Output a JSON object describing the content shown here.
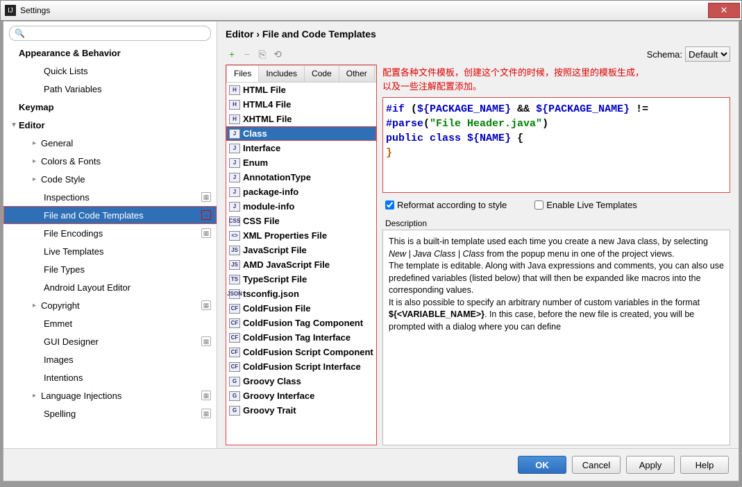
{
  "title": "Settings",
  "breadcrumb": "Editor › File and Code Templates",
  "schema_label": "Schema:",
  "schema_value": "Default",
  "annotation_line1": "配置各种文件模板，创建这个文件的时候，按照这里的模板生成，",
  "annotation_line2": "以及一些注解配置添加。",
  "tree": {
    "appearance": "Appearance & Behavior",
    "quick_lists": "Quick Lists",
    "path_variables": "Path Variables",
    "keymap": "Keymap",
    "editor": "Editor",
    "general": "General",
    "colors": "Colors & Fonts",
    "code_style": "Code Style",
    "inspections": "Inspections",
    "file_templates": "File and Code Templates",
    "file_encodings": "File Encodings",
    "live_templates": "Live Templates",
    "file_types": "File Types",
    "android_layout": "Android Layout Editor",
    "copyright": "Copyright",
    "emmet": "Emmet",
    "gui_designer": "GUI Designer",
    "images": "Images",
    "intentions": "Intentions",
    "language_injections": "Language Injections",
    "spelling": "Spelling"
  },
  "tabs": {
    "files": "Files",
    "includes": "Includes",
    "code": "Code",
    "other": "Other"
  },
  "templates": [
    {
      "icon": "H",
      "label": "HTML File"
    },
    {
      "icon": "H",
      "label": "HTML4 File"
    },
    {
      "icon": "H",
      "label": "XHTML File"
    },
    {
      "icon": "J",
      "label": "Class",
      "selected": true
    },
    {
      "icon": "J",
      "label": "Interface"
    },
    {
      "icon": "J",
      "label": "Enum"
    },
    {
      "icon": "J",
      "label": "AnnotationType"
    },
    {
      "icon": "J",
      "label": "package-info"
    },
    {
      "icon": "J",
      "label": "module-info"
    },
    {
      "icon": "CSS",
      "label": "CSS File"
    },
    {
      "icon": "<>",
      "label": "XML Properties File"
    },
    {
      "icon": "JS",
      "label": "JavaScript File"
    },
    {
      "icon": "JS",
      "label": "AMD JavaScript File"
    },
    {
      "icon": "TS",
      "label": "TypeScript File"
    },
    {
      "icon": "JSON",
      "label": "tsconfig.json"
    },
    {
      "icon": "CF",
      "label": "ColdFusion File"
    },
    {
      "icon": "CF",
      "label": "ColdFusion Tag Component"
    },
    {
      "icon": "CF",
      "label": "ColdFusion Tag Interface"
    },
    {
      "icon": "CF",
      "label": "ColdFusion Script Component"
    },
    {
      "icon": "CF",
      "label": "ColdFusion Script Interface"
    },
    {
      "icon": "G",
      "label": "Groovy Class"
    },
    {
      "icon": "G",
      "label": "Groovy Interface"
    },
    {
      "icon": "G",
      "label": "Groovy Trait"
    }
  ],
  "code": {
    "l1a": "#if",
    "l1b": " (",
    "l1c": "${",
    "l1d": "PACKAGE_NAME",
    "l1e": "}",
    "l1f": " && ",
    "l1g": "${",
    "l1h": "PACKAGE_NAME",
    "l1i": "}",
    "l1j": " !=",
    "l2a": "#parse",
    "l2b": "(",
    "l2c": "\"File Header.java\"",
    "l2d": ")",
    "l3a": "public class ",
    "l3b": "${",
    "l3c": "NAME",
    "l3d": "}",
    "l3e": " {",
    "l4": "}"
  },
  "opt_reformat": "Reformat according to style",
  "opt_live": "Enable Live Templates",
  "desc_label": "Description",
  "desc_p1a": "This is a built-in template used each time you create a new Java class, by selecting ",
  "desc_p1b": "New | Java Class | Class",
  "desc_p1c": " from the popup menu in one of the project views.",
  "desc_p2": "The template is editable. Along with Java expressions and comments, you can also use predefined variables (listed below) that will then be expanded like macros into the corresponding values.",
  "desc_p3a": "It is also possible to specify an arbitrary number of custom variables in the format ",
  "desc_p3b": "${<VARIABLE_NAME>}",
  "desc_p3c": ". In this case, before the new file is created, you will be prompted with a dialog where you can define",
  "buttons": {
    "ok": "OK",
    "cancel": "Cancel",
    "apply": "Apply",
    "help": "Help"
  }
}
